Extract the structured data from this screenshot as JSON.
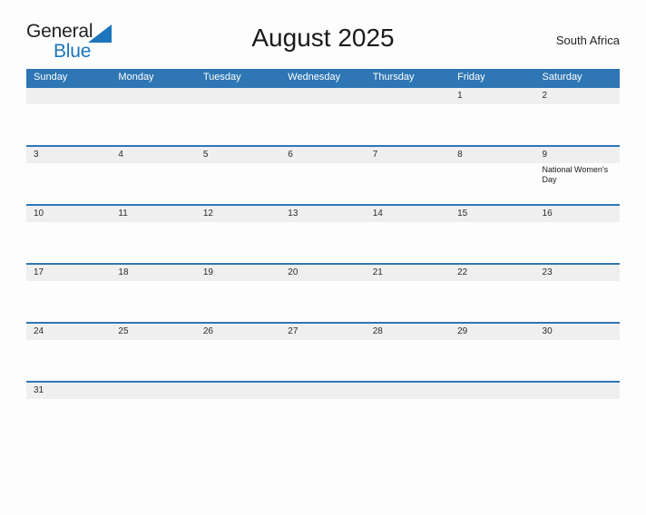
{
  "brand": {
    "word_one": "General",
    "word_two": "Blue",
    "triangle_icon": "triangle-icon",
    "color_dark": "#231f20",
    "color_blue": "#1b75bc"
  },
  "header": {
    "title": "August 2025",
    "region": "South Africa"
  },
  "colors": {
    "header_blue": "#2e76b4",
    "row_rule_blue": "#2e76b4",
    "daynum_band": "#efefef",
    "page_background": "#fdfdfd",
    "text_dark": "#1a1a1a"
  },
  "calendar": {
    "weekdays": [
      "Sunday",
      "Monday",
      "Tuesday",
      "Wednesday",
      "Thursday",
      "Friday",
      "Saturday"
    ],
    "weeks": [
      {
        "days": [
          {
            "num": "",
            "event": ""
          },
          {
            "num": "",
            "event": ""
          },
          {
            "num": "",
            "event": ""
          },
          {
            "num": "",
            "event": ""
          },
          {
            "num": "",
            "event": ""
          },
          {
            "num": "1",
            "event": ""
          },
          {
            "num": "2",
            "event": ""
          }
        ]
      },
      {
        "days": [
          {
            "num": "3",
            "event": ""
          },
          {
            "num": "4",
            "event": ""
          },
          {
            "num": "5",
            "event": ""
          },
          {
            "num": "6",
            "event": ""
          },
          {
            "num": "7",
            "event": ""
          },
          {
            "num": "8",
            "event": ""
          },
          {
            "num": "9",
            "event": "National Women's Day"
          }
        ]
      },
      {
        "days": [
          {
            "num": "10",
            "event": ""
          },
          {
            "num": "11",
            "event": ""
          },
          {
            "num": "12",
            "event": ""
          },
          {
            "num": "13",
            "event": ""
          },
          {
            "num": "14",
            "event": ""
          },
          {
            "num": "15",
            "event": ""
          },
          {
            "num": "16",
            "event": ""
          }
        ]
      },
      {
        "days": [
          {
            "num": "17",
            "event": ""
          },
          {
            "num": "18",
            "event": ""
          },
          {
            "num": "19",
            "event": ""
          },
          {
            "num": "20",
            "event": ""
          },
          {
            "num": "21",
            "event": ""
          },
          {
            "num": "22",
            "event": ""
          },
          {
            "num": "23",
            "event": ""
          }
        ]
      },
      {
        "days": [
          {
            "num": "24",
            "event": ""
          },
          {
            "num": "25",
            "event": ""
          },
          {
            "num": "26",
            "event": ""
          },
          {
            "num": "27",
            "event": ""
          },
          {
            "num": "28",
            "event": ""
          },
          {
            "num": "29",
            "event": ""
          },
          {
            "num": "30",
            "event": ""
          }
        ]
      },
      {
        "days": [
          {
            "num": "31",
            "event": ""
          },
          {
            "num": "",
            "event": ""
          },
          {
            "num": "",
            "event": ""
          },
          {
            "num": "",
            "event": ""
          },
          {
            "num": "",
            "event": ""
          },
          {
            "num": "",
            "event": ""
          },
          {
            "num": "",
            "event": ""
          }
        ]
      }
    ]
  }
}
